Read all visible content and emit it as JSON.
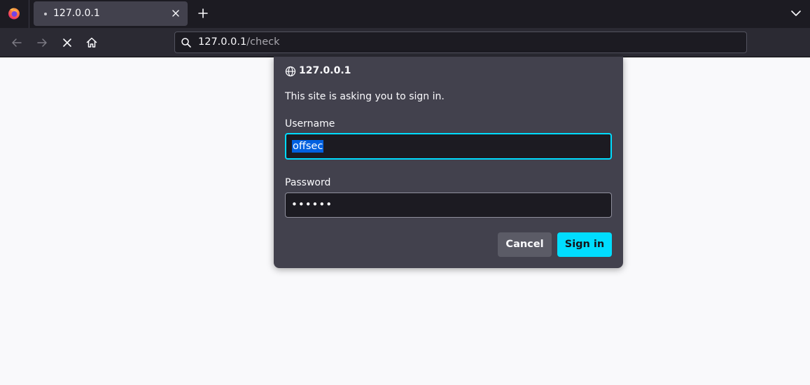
{
  "browser": {
    "tab": {
      "title": "127.0.0.1"
    },
    "urlbar": {
      "host": "127.0.0.1",
      "path": "/check"
    }
  },
  "dialog": {
    "host": "127.0.0.1",
    "message": "This site is asking you to sign in.",
    "username": {
      "label": "Username",
      "value": "offsec"
    },
    "password": {
      "label": "Password",
      "value": "••••••"
    },
    "cancel_label": "Cancel",
    "signin_label": "Sign in"
  },
  "colors": {
    "accent": "#00ddff",
    "selection": "#0061e0",
    "dialog_bg": "#42414d",
    "toolbar_bg": "#2b2a33",
    "tabstrip_bg": "#1c1b22"
  },
  "icons": [
    "firefox-logo",
    "tab-close-icon",
    "new-tab-icon",
    "tab-list-icon",
    "back-icon",
    "forward-icon",
    "stop-icon",
    "home-icon",
    "search-icon",
    "globe-icon"
  ]
}
